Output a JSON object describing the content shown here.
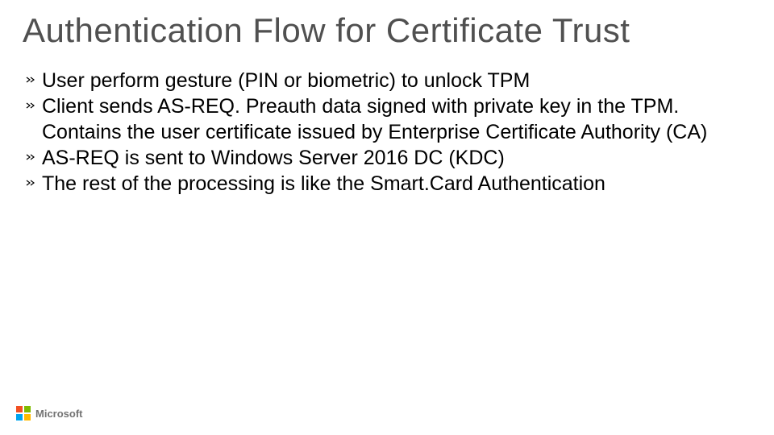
{
  "title": "Authentication Flow for Certificate Trust",
  "bullets": [
    "User perform gesture  (PIN or biometric) to unlock TPM",
    "Client sends AS-REQ. Preauth data signed with private key in the TPM. Contains the user certificate issued by Enterprise Certificate Authority (CA)",
    "AS-REQ is sent to Windows Server 2016 DC (KDC)",
    "The rest of the processing is like the Smart.Card Authentication"
  ],
  "footer": {
    "brand": "Microsoft"
  }
}
